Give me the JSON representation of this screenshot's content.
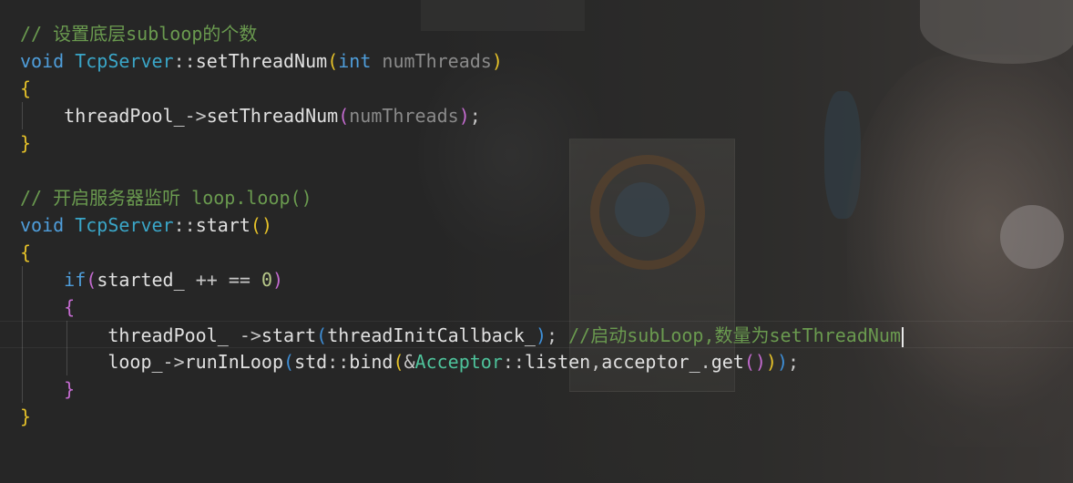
{
  "editor": {
    "lines": [
      {
        "tokens": [
          "// 设置底层subloop的个数"
        ]
      },
      {
        "tokens": [
          "void",
          " ",
          "TcpServer",
          "::",
          "setThreadNum",
          "(",
          "int",
          " ",
          "numThreads",
          ")"
        ]
      },
      {
        "tokens": [
          "{"
        ]
      },
      {
        "tokens": [
          "    ",
          "threadPool_",
          "->",
          "setThreadNum",
          "(",
          "numThreads",
          ")",
          ";"
        ]
      },
      {
        "tokens": [
          "}"
        ]
      },
      {
        "tokens": [
          ""
        ]
      },
      {
        "tokens": [
          "// 开启服务器监听 loop.loop()"
        ]
      },
      {
        "tokens": [
          "void",
          " ",
          "TcpServer",
          "::",
          "start",
          "(",
          ")"
        ]
      },
      {
        "tokens": [
          "{"
        ]
      },
      {
        "tokens": [
          "    ",
          "if",
          "(",
          "started_ ",
          "++",
          " == ",
          "0",
          ")"
        ]
      },
      {
        "tokens": [
          "    ",
          "{"
        ]
      },
      {
        "tokens": [
          "        ",
          "threadPool_ ",
          "->",
          "start",
          "(",
          "threadInitCallback_",
          ")",
          ";",
          " ",
          "//启动subLoop,数量为setThreadNum"
        ]
      },
      {
        "tokens": [
          "        ",
          "loop_",
          "->",
          "runInLoop",
          "(",
          "std",
          "::",
          "bind",
          "(",
          "&",
          "Acceptor",
          "::",
          "listen",
          ",",
          "acceptor_",
          ".",
          "get",
          "(",
          ")",
          ")",
          ")",
          ";"
        ]
      },
      {
        "tokens": [
          "    ",
          "}"
        ]
      },
      {
        "tokens": [
          "}"
        ]
      }
    ],
    "current_line": 12,
    "colors": {
      "background": "#2b2b2b",
      "comment": "#6a9a4f",
      "keyword": "#4f9edb",
      "class": "#3aa6c8",
      "bracket_level1": "#e6c229",
      "bracket_level2": "#c46bd0",
      "bracket_level3": "#3e8fd8"
    }
  }
}
